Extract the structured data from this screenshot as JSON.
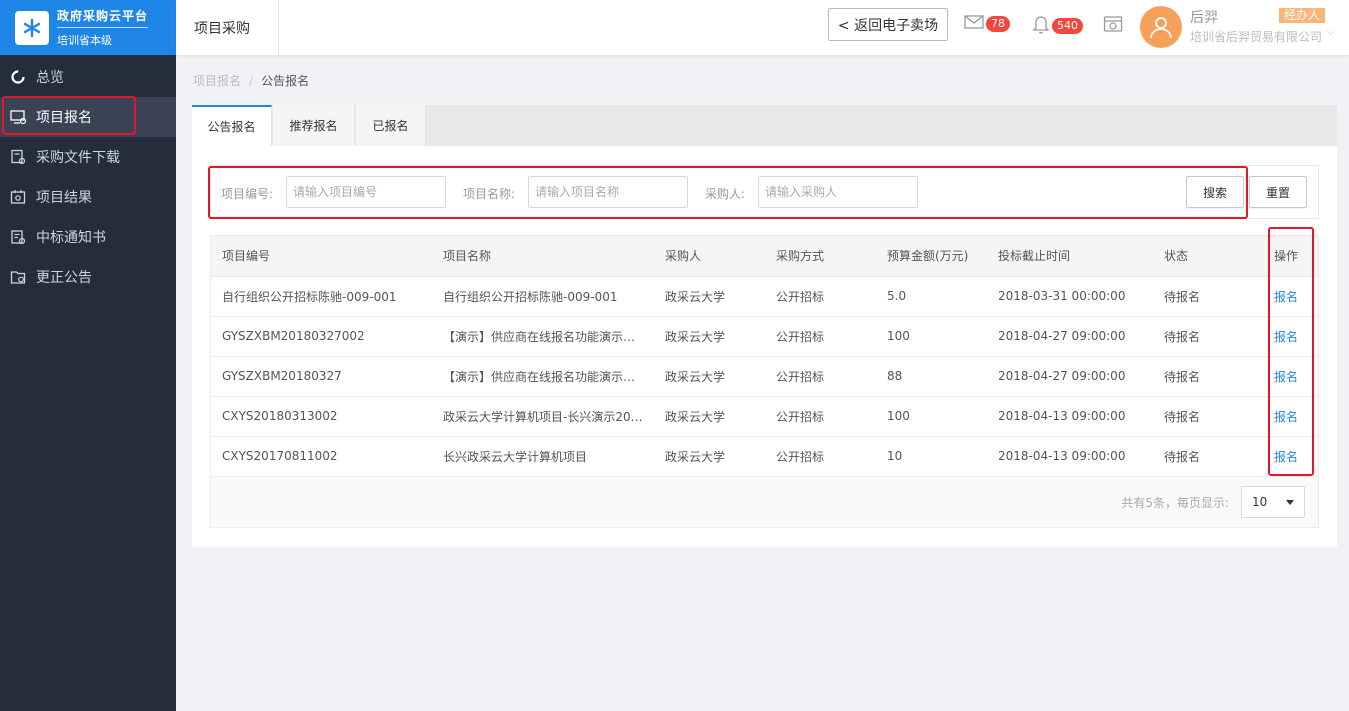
{
  "platform": {
    "title": "政府采购云平台",
    "subtitle": "培训省本级"
  },
  "sidebar": {
    "items": [
      {
        "label": "总览",
        "icon": "dashboard-icon"
      },
      {
        "label": "项目报名",
        "icon": "register-icon",
        "active": true
      },
      {
        "label": "采购文件下载",
        "icon": "download-icon"
      },
      {
        "label": "项目结果",
        "icon": "result-icon"
      },
      {
        "label": "中标通知书",
        "icon": "notice-icon"
      },
      {
        "label": "更正公告",
        "icon": "correction-icon"
      }
    ]
  },
  "header": {
    "title": "项目采购",
    "back_button": "< 返回电子卖场",
    "mail_count": "78",
    "bell_count": "540",
    "user": {
      "name": "后羿",
      "role": "经办人",
      "company": "培训省后羿贸易有限公司"
    }
  },
  "breadcrumb": {
    "parent": "项目报名",
    "separator": "/",
    "current": "公告报名"
  },
  "tabs": [
    "公告报名",
    "推荐报名",
    "已报名"
  ],
  "filters": {
    "project_code": {
      "label": "项目编号:",
      "placeholder": "请输入项目编号"
    },
    "project_name": {
      "label": "项目名称:",
      "placeholder": "请输入项目名称"
    },
    "purchaser": {
      "label": "采购人:",
      "placeholder": "请输入采购人"
    },
    "search_button": "搜索",
    "reset_button": "重置"
  },
  "table": {
    "columns": [
      "项目编号",
      "项目名称",
      "采购人",
      "采购方式",
      "预算金额(万元)",
      "投标截止时间",
      "状态",
      "操作"
    ],
    "rows": [
      [
        "自行组织公开招标陈驰-009-001",
        "自行组织公开招标陈驰-009-001",
        "政采云大学",
        "公开招标",
        "5.0",
        "2018-03-31 00:00:00",
        "待报名",
        "报名"
      ],
      [
        "GYSZXBM20180327002",
        "【演示】供应商在线报名功能演示…",
        "政采云大学",
        "公开招标",
        "100",
        "2018-04-27 09:00:00",
        "待报名",
        "报名"
      ],
      [
        "GYSZXBM20180327",
        "【演示】供应商在线报名功能演示…",
        "政采云大学",
        "公开招标",
        "88",
        "2018-04-27 09:00:00",
        "待报名",
        "报名"
      ],
      [
        "CXYS20180313002",
        "政采云大学计算机项目-长兴演示20…",
        "政采云大学",
        "公开招标",
        "100",
        "2018-04-13 09:00:00",
        "待报名",
        "报名"
      ],
      [
        "CXYS20170811002",
        "长兴政采云大学计算机项目",
        "政采云大学",
        "公开招标",
        "10",
        "2018-04-13 09:00:00",
        "待报名",
        "报名"
      ]
    ]
  },
  "pagination": {
    "summary": "共有5条，每页显示:",
    "page_size": "10"
  },
  "colors": {
    "primary": "#1f86e8",
    "sidebar": "#252c3c",
    "highlight": "#e3172b",
    "badge": "#f4463a"
  }
}
